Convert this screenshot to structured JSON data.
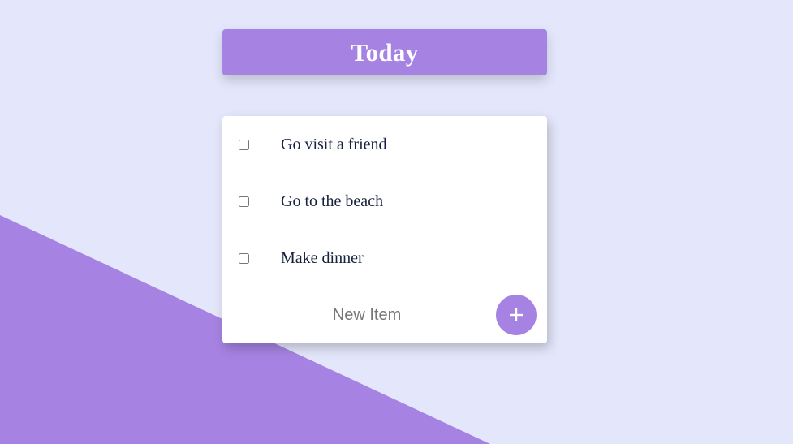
{
  "colors": {
    "background": "#E4E7FB",
    "accent": "#A683E3",
    "card": "#FFFFFF",
    "text": "#16213E"
  },
  "header": {
    "title": "Today"
  },
  "todo": {
    "items": [
      {
        "label": "Go visit a friend",
        "checked": false
      },
      {
        "label": "Go to the beach",
        "checked": false
      },
      {
        "label": "Make dinner",
        "checked": false
      }
    ],
    "new_item": {
      "placeholder": "New Item",
      "value": ""
    },
    "add_button": {
      "icon": "plus-icon",
      "label": "+"
    }
  }
}
